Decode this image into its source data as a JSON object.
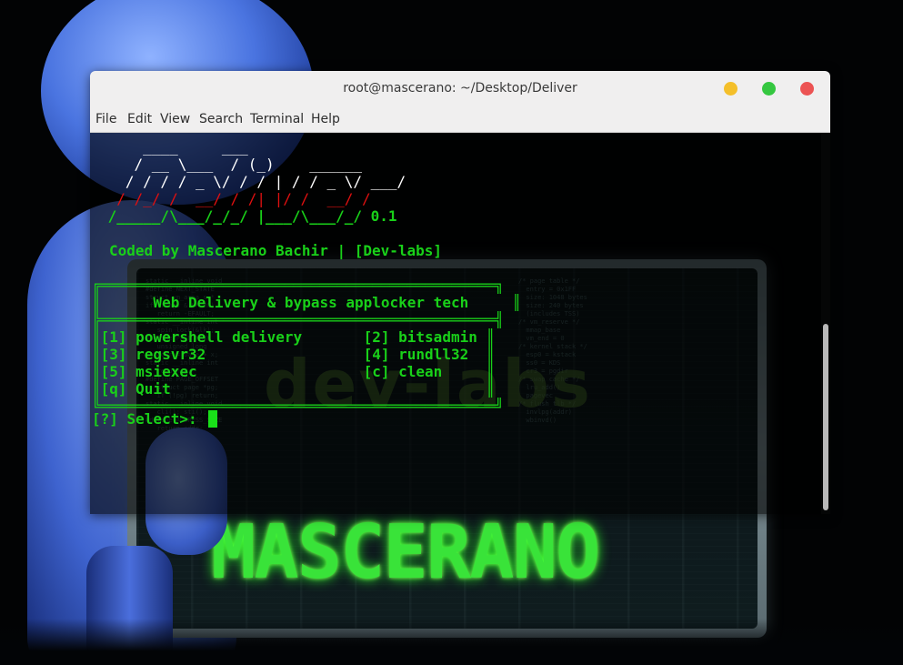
{
  "window": {
    "title": "root@mascerano: ~/Desktop/Deliver",
    "menu": [
      "File",
      "Edit",
      "View",
      "Search",
      "Terminal",
      "Help"
    ]
  },
  "banner": {
    "ascii_lines": [
      "     ____     ___",
      "    / __ \\___  / (_)    ______",
      "   / / / / _ \\/ / / | / / _ \\/ ___/",
      "  / /_/ /  __/ / /| |/ /  __/ /",
      " /_____/\\___/_/_/ |___/\\___/_/ 0.1"
    ],
    "credit": "Coded by Mascerano Bachir | [Dev-labs]"
  },
  "menu_box": {
    "top": "╔═════════════════════════════════════════════╗",
    "title": "║      Web Delivery & bypass applocker tech     ║",
    "sep": "╠═════════════════════════════════════════════╣",
    "rows": [
      "║[1] powershell delivery       [2] bitsadmin ║",
      "║[3] regsvr32                  [4] rundll32  ║",
      "║[5] msiexec                   [c] clean     ║",
      "║[q] Quit                                    ║"
    ],
    "bottom": "╚═════════════════════════════════════════════╝"
  },
  "prompt": "[?] Select>: ",
  "wallpaper": {
    "brand": "MASCERANO",
    "watermark": "dev-labs"
  },
  "colors": {
    "terminal_green": "#19d019",
    "ascii_red": "#e01010",
    "btn_min": "#f4bf2a",
    "btn_max": "#35c740",
    "btn_close": "#ec5353"
  }
}
